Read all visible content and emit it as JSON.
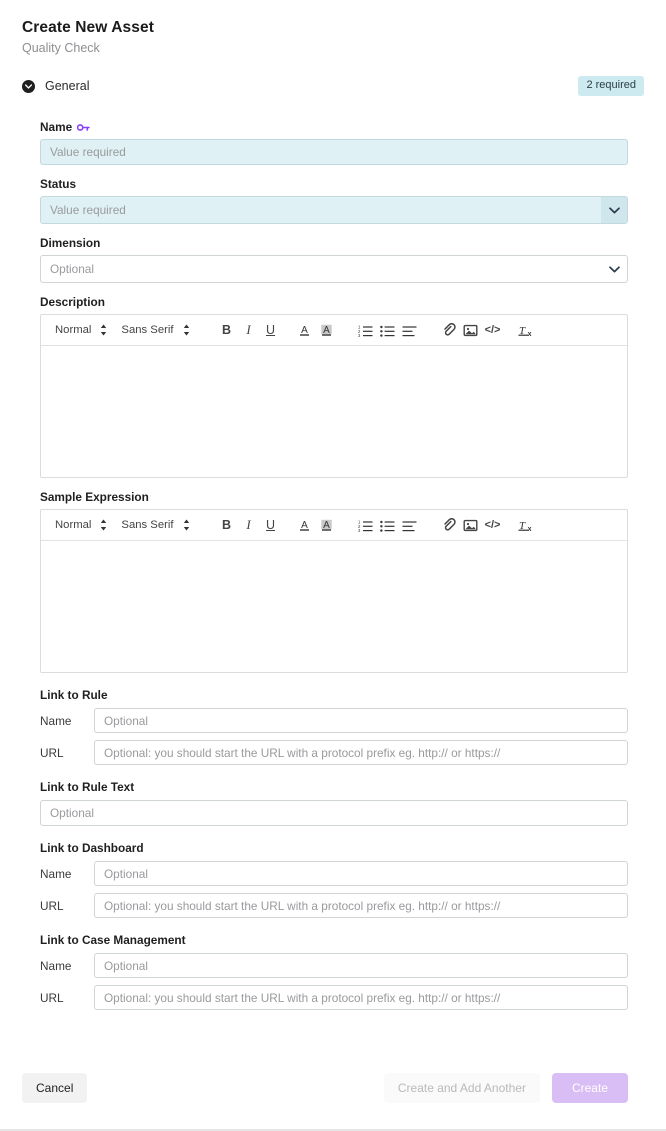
{
  "header": {
    "title": "Create New Asset",
    "subtitle": "Quality Check"
  },
  "section": {
    "label": "General",
    "badge": "2 required",
    "collapse_icon": "chevron-down-circle-icon"
  },
  "fields": {
    "name": {
      "label": "Name",
      "key_icon": "key-icon",
      "placeholder": "Value required",
      "value": "",
      "required": true
    },
    "status": {
      "label": "Status",
      "placeholder": "Value required",
      "value": "",
      "required": true,
      "caret_icon": "chevron-down-icon"
    },
    "dimension": {
      "label": "Dimension",
      "placeholder": "Optional",
      "value": "",
      "required": false,
      "caret_icon": "chevron-down-icon"
    },
    "description": {
      "label": "Description",
      "value": ""
    },
    "sample_expression": {
      "label": "Sample Expression",
      "value": ""
    }
  },
  "editor_toolbar": {
    "heading_option": "Normal",
    "font_option": "Sans Serif",
    "buttons": [
      {
        "name": "bold-icon",
        "glyph": "B"
      },
      {
        "name": "italic-icon",
        "glyph": "I"
      },
      {
        "name": "underline-icon",
        "glyph": "U"
      },
      {
        "name": "font-color-icon",
        "glyph": "A"
      },
      {
        "name": "highlight-color-icon",
        "glyph": "A"
      },
      {
        "name": "ordered-list-icon",
        "glyph": ""
      },
      {
        "name": "bullet-list-icon",
        "glyph": ""
      },
      {
        "name": "align-left-icon",
        "glyph": ""
      },
      {
        "name": "link-icon",
        "glyph": ""
      },
      {
        "name": "image-icon",
        "glyph": ""
      },
      {
        "name": "code-block-icon",
        "glyph": "</>"
      },
      {
        "name": "clear-formatting-icon",
        "glyph": "Tx"
      }
    ]
  },
  "link_groups": {
    "rule": {
      "title": "Link to Rule",
      "name_label": "Name",
      "name_placeholder": "Optional",
      "name_value": "",
      "url_label": "URL",
      "url_placeholder": "Optional: you should start the URL with a protocol prefix eg. http:// or https://",
      "url_value": ""
    },
    "rule_text": {
      "title": "Link to Rule Text",
      "placeholder": "Optional",
      "value": ""
    },
    "dashboard": {
      "title": "Link to Dashboard",
      "name_label": "Name",
      "name_placeholder": "Optional",
      "name_value": "",
      "url_label": "URL",
      "url_placeholder": "Optional: you should start the URL with a protocol prefix eg. http:// or https://",
      "url_value": ""
    },
    "case_management": {
      "title": "Link to Case Management",
      "name_label": "Name",
      "name_placeholder": "Optional",
      "name_value": "",
      "url_label": "URL",
      "url_placeholder": "Optional: you should start the URL with a protocol prefix eg. http:// or https://",
      "url_value": ""
    }
  },
  "footer": {
    "cancel": "Cancel",
    "create_and_add_another": "Create and Add Another",
    "create": "Create"
  },
  "colors": {
    "required_field_bg": "#dff1f5",
    "badge_bg": "#cdeaf0",
    "primary_button_bg": "#d9bdf5",
    "key_icon": "#8a3ffc"
  }
}
